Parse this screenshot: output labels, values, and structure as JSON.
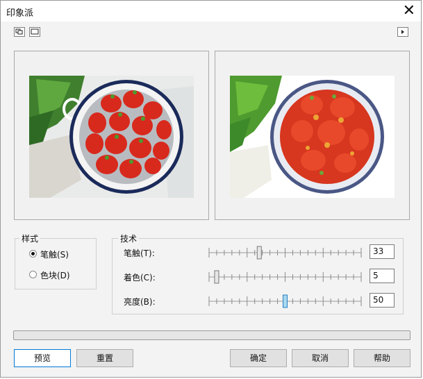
{
  "window": {
    "title": "印象派",
    "close_glyph": "✕"
  },
  "toolbar": {
    "icons": [
      "dual-preview-icon",
      "single-preview-icon",
      "expand-arrow-icon"
    ]
  },
  "style_group": {
    "legend": "样式",
    "options": [
      {
        "label": "笔触(S)",
        "selected": true
      },
      {
        "label": "色块(D)",
        "selected": false
      }
    ]
  },
  "technique_group": {
    "legend": "技术",
    "sliders": [
      {
        "label": "笔触(T):",
        "value": "33",
        "fraction": 0.33
      },
      {
        "label": "着色(C):",
        "value": "5",
        "fraction": 0.05
      },
      {
        "label": "亮度(B):",
        "value": "50",
        "fraction": 0.5
      }
    ]
  },
  "progress": {
    "fraction": 0
  },
  "buttons": {
    "preview": "预览",
    "reset": "重置",
    "ok": "确定",
    "cancel": "取消",
    "help": "帮助"
  },
  "colors": {
    "focus_border": "#0078d7",
    "thumb_fill": "#a8d8f0",
    "bowl_rim": "#1a2a5a",
    "strawberry": "#d8291d"
  }
}
